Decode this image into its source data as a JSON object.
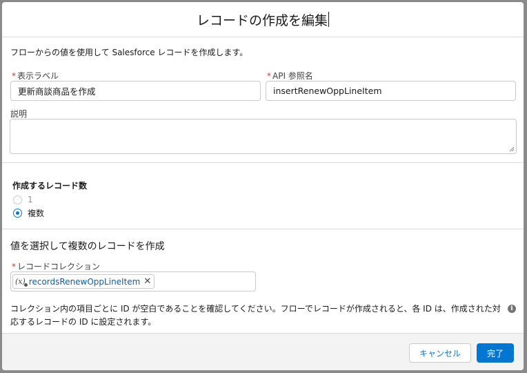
{
  "modal": {
    "title": "レコードの作成を編集"
  },
  "intro": {
    "description": "フローからの値を使用して Salesforce レコードを作成します。"
  },
  "fields": {
    "label": {
      "label": "表示ラベル",
      "value": "更新商談商品を作成"
    },
    "api_name": {
      "label": "API 参照名",
      "value": "insertRenewOppLineItem"
    },
    "description": {
      "label": "説明",
      "value": ""
    },
    "required_marker": "*"
  },
  "record_count": {
    "label": "作成するレコード数",
    "options": [
      {
        "label": "1",
        "checked": false
      },
      {
        "label": "複数",
        "checked": true
      }
    ]
  },
  "multiple": {
    "title": "値を選択して複数のレコードを作成",
    "collection_label": "レコードコレクション",
    "collection_value": "recordsRenewOppLineItem",
    "pill_icon": "(x)",
    "pill_close": "✕",
    "help_text": "コレクション内の項目ごとに ID が空白であることを確認してください。フローでレコードが作成されると、各 ID は、作成された対応するレコードの ID に設定されます。"
  },
  "footer": {
    "cancel_label": "キャンセル",
    "done_label": "完了"
  },
  "colors": {
    "brand": "#0176d3",
    "required": "#c23934",
    "pill_text": "#0b5cab"
  },
  "icons": {
    "variable": "variable-icon",
    "close": "close-icon",
    "info": "info-icon",
    "resize": "resize-handle-icon"
  }
}
